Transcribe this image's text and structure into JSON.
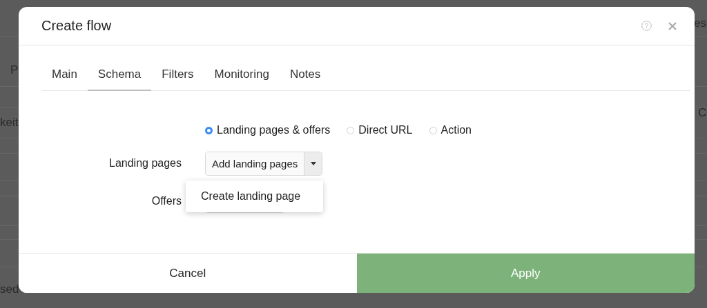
{
  "background": {
    "fragments": [
      "P",
      "keit",
      "sed",
      "es",
      "C"
    ]
  },
  "dialog": {
    "title": "Create flow",
    "tabs": [
      {
        "label": "Main",
        "selected": false
      },
      {
        "label": "Schema",
        "selected": true
      },
      {
        "label": "Filters",
        "selected": false
      },
      {
        "label": "Monitoring",
        "selected": false
      },
      {
        "label": "Notes",
        "selected": false
      }
    ],
    "schema_options": [
      {
        "label": "Landing pages & offers",
        "selected": true
      },
      {
        "label": "Direct URL",
        "selected": false
      },
      {
        "label": "Action",
        "selected": false
      }
    ],
    "fields": [
      {
        "label": "Landing pages",
        "kind": "dropdown",
        "value": "Add landing pages"
      },
      {
        "label": "Offers",
        "kind": "covered"
      }
    ],
    "menu": {
      "items": [
        "Create landing page"
      ]
    },
    "buttons": [
      {
        "label": "Cancel",
        "kind": "secondary"
      },
      {
        "label": "Apply",
        "kind": "primary"
      }
    ]
  }
}
